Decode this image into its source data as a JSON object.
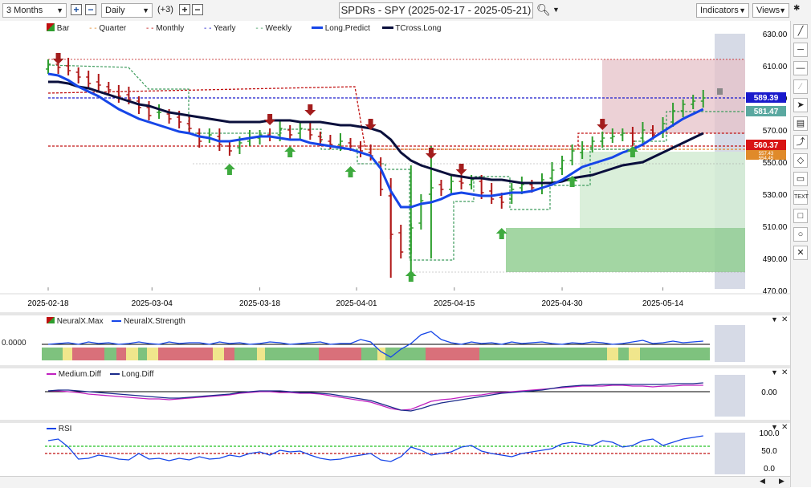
{
  "toolbar": {
    "period": "3 Months",
    "interval": "Daily",
    "offset": "(+3)",
    "title": "SPDRs - SPY (2025-02-17 - 2025-05-21)",
    "indicators_label": "Indicators",
    "views_label": "Views"
  },
  "main_legend": [
    "Bar",
    "Quarter",
    "Monthly",
    "Yearly",
    "Weekly",
    "Long.Predict",
    "TCross.Long"
  ],
  "main_axis": [
    "630.00",
    "610.00",
    "590.00",
    "570.00",
    "550.00",
    "530.00",
    "510.00",
    "490.00",
    "470.00"
  ],
  "price_tags": {
    "yearly": "589.39",
    "weekly": "581.47",
    "last": "560.37",
    "quarter_a": "557.43",
    "quarter_b": "554.45"
  },
  "date_labels": [
    "2025-02-18",
    "2025-03-04",
    "2025-03-18",
    "2025-04-01",
    "2025-04-15",
    "2025-04-30",
    "2025-05-14"
  ],
  "neural": {
    "legend": [
      "NeuralX.Max",
      "NeuralX.Strength"
    ],
    "value": "0.0000"
  },
  "diff": {
    "legend": [
      "Medium.Diff",
      "Long.Diff"
    ],
    "axis": "0.00"
  },
  "rsi": {
    "legend": "RSI",
    "axis": [
      "100.0",
      "50.0",
      "0.0"
    ]
  },
  "tools": [
    "line",
    "horizontal",
    "ray",
    "cursor",
    "fib",
    "path",
    "note",
    "TEXT",
    "rect",
    "circle",
    "clear"
  ],
  "colors": {
    "up": "#2e9e2e",
    "down": "#b01818",
    "predict": "#1646e8",
    "tcross": "#0a0f3c",
    "yearly": "#1a1acc",
    "monthly": "#c01010",
    "quarter": "#e08a2a",
    "weekly": "#3a9a5a"
  },
  "chart_data": {
    "type": "candlestick",
    "series": [
      {
        "name": "Long.Predict",
        "values": [
          605,
          604,
          601,
          597,
          594,
          591,
          587,
          583,
          580,
          577,
          575,
          573,
          571,
          569,
          568,
          566,
          565,
          563,
          563,
          564,
          565,
          566,
          566,
          565,
          564,
          564,
          562,
          561,
          560,
          559,
          558,
          556,
          554,
          546,
          532,
          522,
          522,
          524,
          525,
          527,
          530,
          531,
          530,
          529,
          529,
          530,
          531,
          531,
          532,
          534,
          536,
          539,
          543,
          547,
          549,
          551,
          553,
          556,
          558,
          561,
          565,
          569,
          573,
          577,
          580,
          583
        ]
      },
      {
        "name": "TCross.Long",
        "values": [
          600,
          600,
          599,
          597,
          596,
          594,
          592,
          590,
          588,
          586,
          585,
          583,
          581,
          580,
          579,
          578,
          577,
          576,
          575,
          575,
          575,
          575,
          576,
          576,
          576,
          575,
          575,
          575,
          574,
          573,
          573,
          572,
          571,
          569,
          564,
          556,
          551,
          548,
          546,
          544,
          542,
          541,
          540,
          540,
          539,
          539,
          538,
          537,
          537,
          537,
          537,
          538,
          540,
          541,
          542,
          544,
          546,
          548,
          549,
          550,
          553,
          556,
          559,
          562,
          565,
          568
        ]
      }
    ],
    "levels": {
      "yearly": 589.39,
      "monthly_mar": 594,
      "monthly_apr": 560.37,
      "monthly_may": 575,
      "weekly_last": 581.47,
      "quarter_a": 557.43,
      "quarter_b": 554.45
    },
    "ylim": [
      470,
      630
    ]
  }
}
